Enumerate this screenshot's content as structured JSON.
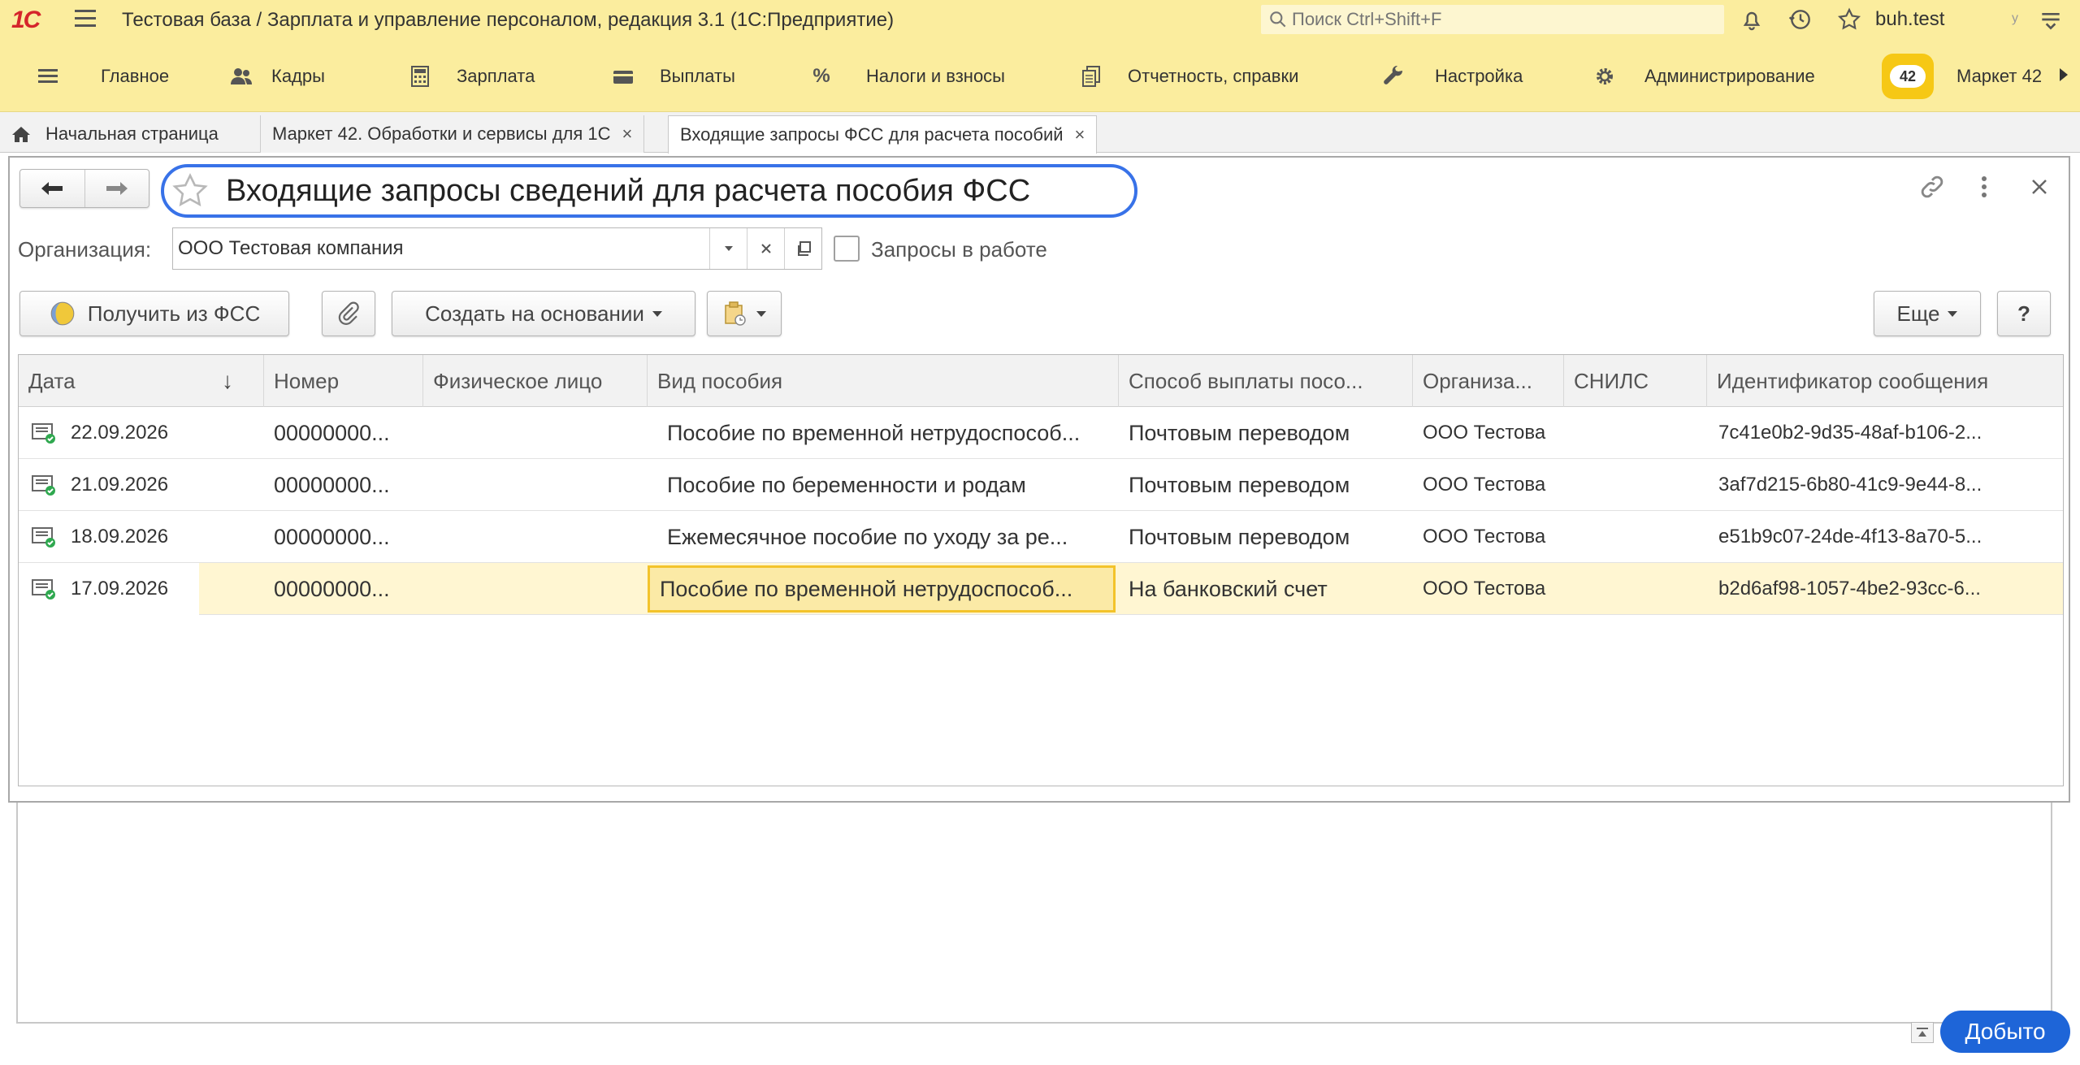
{
  "titlebar": {
    "logo": "1С",
    "title": "Тестовая база / Зарплата и управление персоналом, редакция 3.1  (1С:Предприятие)",
    "search_placeholder": "Поиск Ctrl+Shift+F",
    "user": "buh.test",
    "user_extra": "у"
  },
  "menu": {
    "items": [
      {
        "label": "Главное",
        "icon": "list-icon"
      },
      {
        "label": "Кадры",
        "icon": "people-icon"
      },
      {
        "label": "Зарплата",
        "icon": "calculator-icon"
      },
      {
        "label": "Выплаты",
        "icon": "wallet-icon"
      },
      {
        "label": "Налоги и взносы",
        "icon": "percent-icon"
      },
      {
        "label": "Отчетность, справки",
        "icon": "reports-icon"
      },
      {
        "label": "Настройка",
        "icon": "wrench-icon"
      },
      {
        "label": "Администрирование",
        "icon": "gear-icon"
      }
    ],
    "market_badge": "42",
    "market_label": "Маркет 42"
  },
  "tabs": [
    {
      "label": "Начальная страница"
    },
    {
      "label": "Маркет 42. Обработки и сервисы для 1С"
    },
    {
      "label": "Входящие запросы ФСС для расчета пособий"
    }
  ],
  "form": {
    "title": "Входящие запросы сведений для расчета пособия ФСС",
    "org_label": "Организация:",
    "org_value": "ООО Тестовая компания",
    "in_work_label": "Запросы в работе",
    "in_work_checked": false,
    "buttons": {
      "get_fss": "Получить из ФСС",
      "create_basis": "Создать на основании",
      "more": "Еще",
      "help": "?"
    }
  },
  "table": {
    "columns": [
      "Дата",
      "Номер",
      "Физическое лицо",
      "Вид пособия",
      "Способ выплаты посо...",
      "Организа...",
      "СНИЛС",
      "Идентификатор сообщения"
    ],
    "sort_indicator": "↓",
    "rows": [
      {
        "date": "22.09.2026",
        "number": "00000000...",
        "person": "",
        "benefit": "Пособие по временной нетрудоспособ...",
        "payment": "Почтовым переводом",
        "org": "ООО Тестова",
        "snils": "",
        "msg_id": "7c41e0b2-9d35-48af-b106-2..."
      },
      {
        "date": "21.09.2026",
        "number": "00000000...",
        "person": "",
        "benefit": "Пособие по беременности и родам",
        "payment": "Почтовым переводом",
        "org": "ООО Тестова",
        "snils": "",
        "msg_id": "3af7d215-6b80-41c9-9e44-8..."
      },
      {
        "date": "18.09.2026",
        "number": "00000000...",
        "person": "",
        "benefit": "Ежемесячное пособие по уходу за ре...",
        "payment": "Почтовым переводом",
        "org": "ООО Тестова",
        "snils": "",
        "msg_id": "e51b9c07-24de-4f13-8a70-5..."
      },
      {
        "date": "17.09.2026",
        "number": "00000000...",
        "person": "",
        "benefit": "Пособие по временной нетрудоспособ...",
        "payment": "На банковский счет",
        "org": "ООО Тестова",
        "snils": "",
        "msg_id": "b2d6af98-1057-4be2-93cc-6..."
      }
    ]
  },
  "footer": {
    "dobyto_label": "Добыто"
  },
  "colors": {
    "accent_yellow": "#fbed9e",
    "selection": "#fff6d2",
    "focus_border": "#f3c32b",
    "title_highlight": "#3872e8",
    "dobyto_blue": "#1e65d8"
  }
}
